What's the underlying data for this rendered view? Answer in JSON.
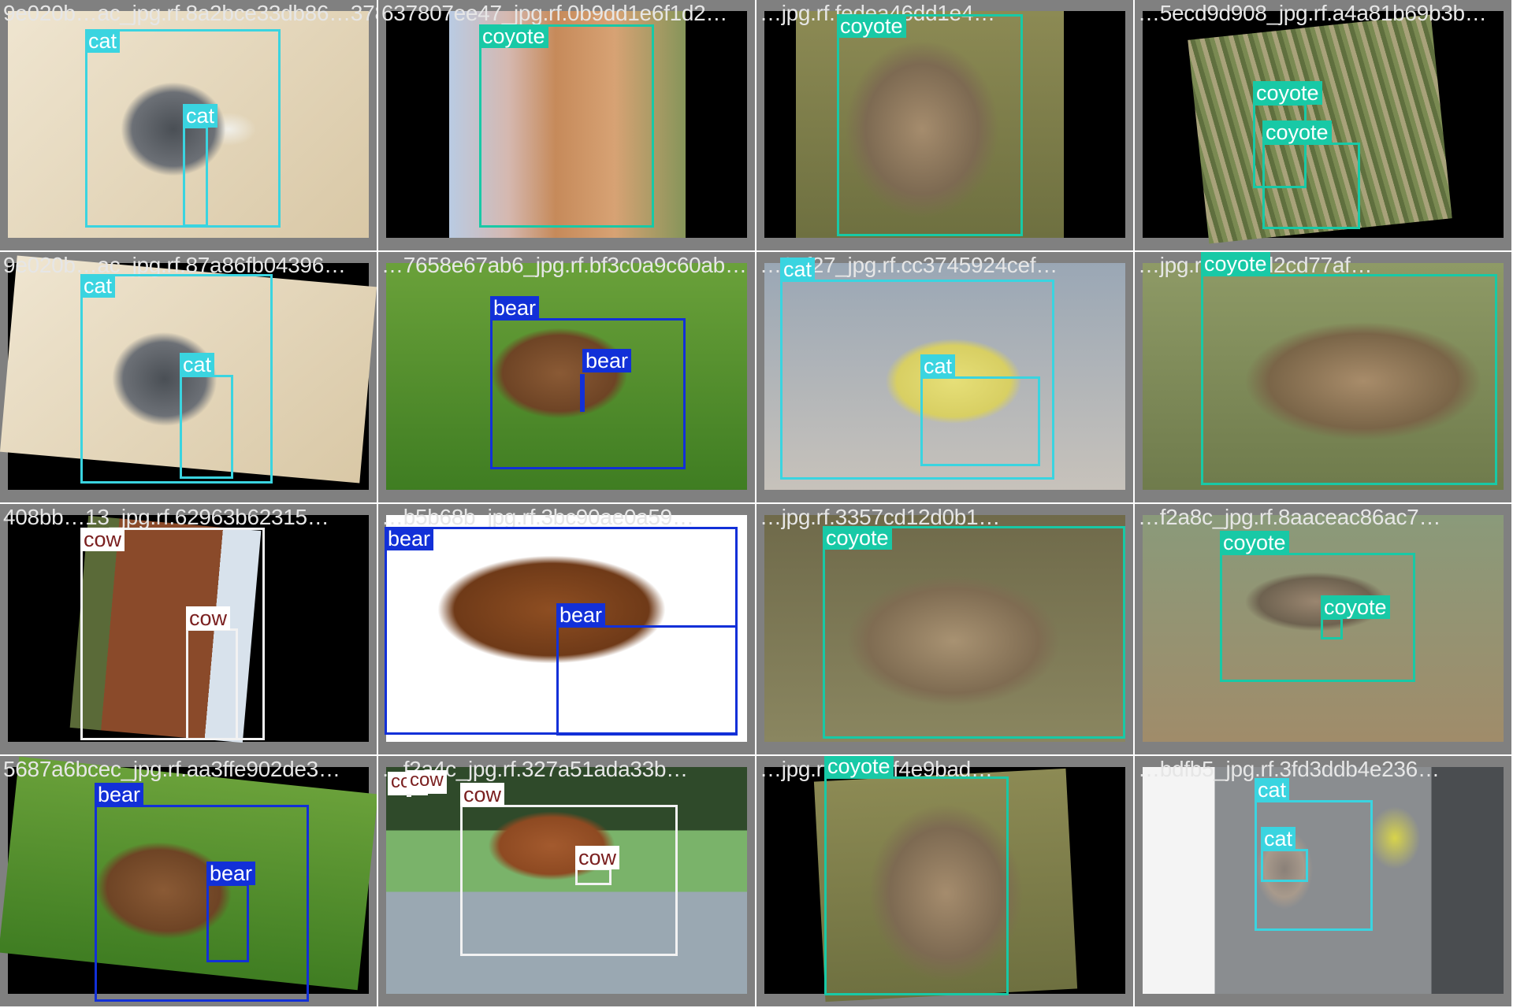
{
  "colors": {
    "cat": "#3ad4e0",
    "coyote": "#18c9a6",
    "bear": "#1230d8",
    "cow": "#ffffff",
    "cow_text": "#7a1f1f",
    "tile_bg": "#808080"
  },
  "tiles": [
    {
      "filename": "9e020b…ac_jpg.rf.8a2bce33db86…37807ee47 jpg.rf.0b9dd1e6f1d2…",
      "labels": [
        "cat",
        "cat"
      ]
    },
    {
      "filename": "637807ee47_jpg.rf.0b9dd1e6f1d2…",
      "labels": [
        "coyote"
      ]
    },
    {
      "filename": "…jpg.rf.fedea46dd1e4…",
      "labels": [
        "coyote"
      ]
    },
    {
      "filename": "…5ecd9d908_jpg.rf.a4a81b69b3b…",
      "labels": [
        "coyote",
        "coyote"
      ]
    },
    {
      "filename": "9e020b…ac_jpg.rf.87a86fb04396…",
      "labels": [
        "cat",
        "cat"
      ]
    },
    {
      "filename": "…7658e67ab6_jpg.rf.bf3c0a9c60ab…",
      "labels": [
        "bear",
        "bear"
      ]
    },
    {
      "filename": "…25f27_jpg.rf.cc3745924cef…",
      "labels": [
        "cat",
        "cat"
      ]
    },
    {
      "filename": "…jpg.rf.9920d2cd77af…",
      "labels": [
        "coyote"
      ]
    },
    {
      "filename": "408bb…13_jpg.rf.62963b62315…",
      "labels": [
        "cow",
        "cow"
      ]
    },
    {
      "filename": "…b5b68b_jpg.rf.3bc90ae0a59…",
      "labels": [
        "bear",
        "bear"
      ]
    },
    {
      "filename": "…jpg.rf.3357cd12d0b1…",
      "labels": [
        "coyote"
      ]
    },
    {
      "filename": "…f2a8c_jpg.rf.8aaceac86ac7…",
      "labels": [
        "coyote",
        "coyote"
      ]
    },
    {
      "filename": "5687a6bcec_jpg.rf.aa3ffe902de3…",
      "labels": [
        "bear",
        "bear"
      ]
    },
    {
      "filename": "…f2a4c_jpg.rf.327a51ada33b…",
      "labels": [
        "cow",
        "cow",
        "cow",
        "cow"
      ]
    },
    {
      "filename": "…jpg.rf.c47c1f4e9bad…",
      "labels": [
        "coyote"
      ]
    },
    {
      "filename": "…bdfb5_jpg.rf.3fd3ddb4e236…",
      "labels": [
        "cat",
        "cat"
      ]
    }
  ]
}
